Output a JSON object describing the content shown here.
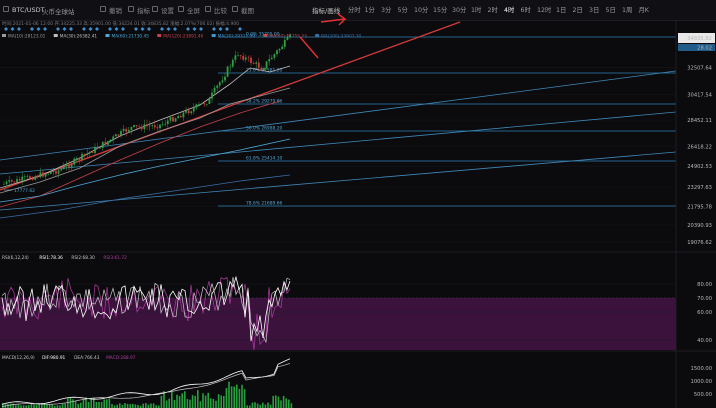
{
  "header": {
    "symbol": "BTC/USDT",
    "exchange": "火币全球站",
    "indicator_select": "指标/画线",
    "timeframes": [
      "分时",
      "1分",
      "3分",
      "5分",
      "10分",
      "15分",
      "30分",
      "1时",
      "2时",
      "4时",
      "6时",
      "12时",
      "1日",
      "2日",
      "3日",
      "5日",
      "1周",
      "月K"
    ],
    "active_timeframe": "4时",
    "tools": [
      {
        "icon": "undo-icon",
        "label": "撤销"
      },
      {
        "icon": "indicator-icon",
        "label": "指标"
      },
      {
        "icon": "settings-icon",
        "label": "设置"
      },
      {
        "icon": "fullscreen-icon",
        "label": "全屏"
      },
      {
        "icon": "compare-icon",
        "label": "比较"
      },
      {
        "icon": "camera-icon",
        "label": "截图"
      }
    ]
  },
  "stats_line": "时间:2021-01-06 12:00  开:34225.33  高:35901.00  低:34224.01  收:34835.82  涨幅:2.07%(706.02)  振幅:4.900",
  "ma_legend": [
    {
      "label": "MA(10):28123.01",
      "color": "#9a9a9a"
    },
    {
      "label": "MA(30):26382.41",
      "color": "#c0c0c0"
    },
    {
      "label": "MA(60):21730.45",
      "color": "#4fa9d6"
    },
    {
      "label": "MA(120):23891.46",
      "color": "#c7434c"
    },
    {
      "label": "MA(20):29311.09",
      "color": "#3d9ad0"
    },
    {
      "label": "MA(40):24755.23",
      "color": "#c7434c"
    },
    {
      "label": "MA(200):23607.30",
      "color": "#3a6ea5"
    }
  ],
  "chart_data": {
    "type": "candlestick",
    "price_axis": [
      "32507.64",
      "30417.54",
      "28452.11",
      "26418.22",
      "24902.53",
      "23297.63",
      "21795.78",
      "20390.93",
      "19076.62"
    ],
    "current_price": "34835.82",
    "current_change": "28.02",
    "low_marker": "17777.62",
    "fib_levels": [
      {
        "label": "0.0% 35705.00"
      },
      {
        "label": "23.6% 31581.20"
      },
      {
        "label": "38.2% 29279.86"
      },
      {
        "label": "50.0% 26988.20"
      },
      {
        "label": "61.8% 25414.10"
      },
      {
        "label": "78.6% 21689.66"
      }
    ],
    "rsi": {
      "legend": [
        "RSI(6,12,24)",
        "RSI1:78.36",
        "RSI2:68.30",
        "RSI3:61.72"
      ],
      "legend_colors": [
        "#c8c8c8",
        "#ffffff",
        "#c8c8c8",
        "#b03ca0"
      ],
      "axis": [
        "80.00",
        "70.00",
        "60.00",
        "40.00"
      ]
    },
    "macd": {
      "legend": [
        "MACD(12,26,9)",
        "DIF:980.91",
        "DEA:766.43",
        "MACD:288.97"
      ],
      "legend_colors": [
        "#c8c8c8",
        "#ffffff",
        "#c8c8c8",
        "#b03ca0"
      ],
      "axis": [
        "1500.00",
        "1000.00",
        "500.00"
      ]
    }
  }
}
